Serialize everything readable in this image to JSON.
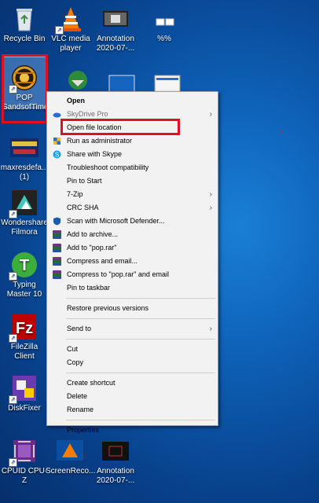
{
  "desktop": {
    "icons": [
      {
        "label": "Recycle Bin"
      },
      {
        "label": "VLC media player"
      },
      {
        "label": "Annotation 2020-07-..."
      },
      {
        "label": "%%"
      },
      {
        "label": "POP SandsofTime"
      },
      {
        "label": "maxresdefa... (1)"
      },
      {
        "label": "Wondershare Filmora"
      },
      {
        "label": "Typing Master 10"
      },
      {
        "label": "FileZilla Client"
      },
      {
        "label": "DiskFixer"
      },
      {
        "label": "CPUID CPU-Z"
      },
      {
        "label": "ScreenReco..."
      },
      {
        "label": "Annotation 2020-07-..."
      }
    ]
  },
  "context_menu": {
    "items": [
      {
        "label": "Open"
      },
      {
        "label": "SkyDrive Pro"
      },
      {
        "label": "Open file location"
      },
      {
        "label": "Run as administrator"
      },
      {
        "label": "Share with Skype"
      },
      {
        "label": "Troubleshoot compatibility"
      },
      {
        "label": "Pin to Start"
      },
      {
        "label": "7-Zip"
      },
      {
        "label": "CRC SHA"
      },
      {
        "label": "Scan with Microsoft Defender..."
      },
      {
        "label": "Add to archive..."
      },
      {
        "label": "Add to \"pop.rar\""
      },
      {
        "label": "Compress and email..."
      },
      {
        "label": "Compress to \"pop.rar\" and email"
      },
      {
        "label": "Pin to taskbar"
      },
      {
        "label": "Restore previous versions"
      },
      {
        "label": "Send to"
      },
      {
        "label": "Cut"
      },
      {
        "label": "Copy"
      },
      {
        "label": "Create shortcut"
      },
      {
        "label": "Delete"
      },
      {
        "label": "Rename"
      },
      {
        "label": "Properties"
      }
    ]
  }
}
